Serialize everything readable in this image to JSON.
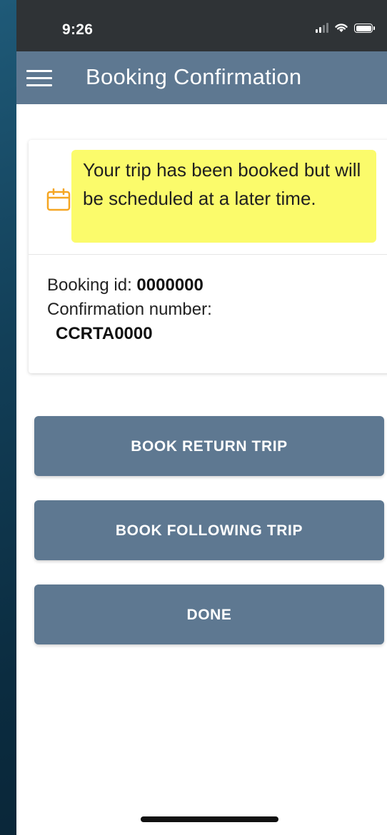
{
  "status_bar": {
    "time": "9:26",
    "icons": [
      "signal-icon",
      "wifi-icon",
      "battery-icon"
    ]
  },
  "app_bar": {
    "title": "Booking Confirmation",
    "menu_icon": "hamburger-menu-icon",
    "color": "#5e7891"
  },
  "confirmation_card": {
    "icon": "calendar-icon",
    "icon_color": "#f5a623",
    "highlight_color": "#fbfb6b",
    "message": "Your trip has been booked but will be scheduled at a later time.",
    "booking_id_label": "Booking id:",
    "booking_id": "0000000",
    "confirmation_label": "Confirmation number:",
    "confirmation_number": "CCRTA0000"
  },
  "actions": {
    "book_return_trip": "BOOK RETURN TRIP",
    "book_following_trip": "BOOK FOLLOWING TRIP",
    "done": "DONE"
  }
}
